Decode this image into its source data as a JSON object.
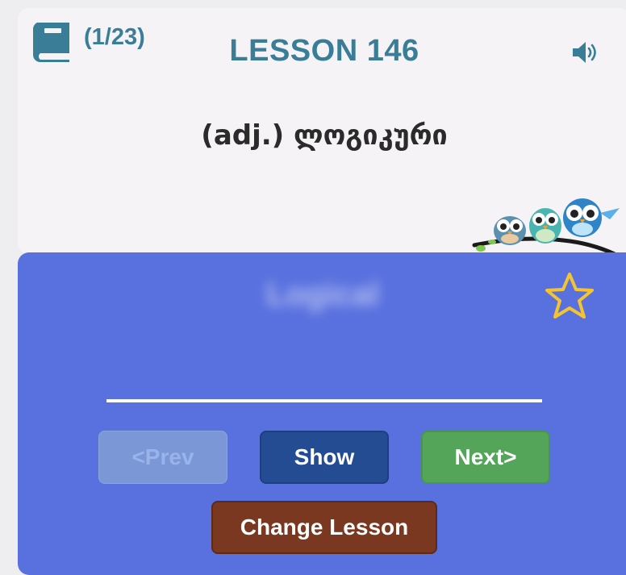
{
  "header": {
    "counter": "(1/23)",
    "lesson_title": "LESSON 146"
  },
  "card": {
    "word": "(adj.) ლოგიკური",
    "answer_hidden": "Logical"
  },
  "buttons": {
    "prev": "<Prev",
    "show": "Show",
    "next": "Next>",
    "change_lesson": "Change Lesson"
  },
  "colors": {
    "accent": "#3a7d97",
    "card_bg": "#5971df",
    "show_button": "#244c93",
    "next_button": "#54a55a",
    "change_lesson_button": "#7a3820",
    "star": "#f4c430"
  },
  "icons": [
    "book-icon",
    "speaker-icon",
    "owls-illustration",
    "star-icon"
  ]
}
